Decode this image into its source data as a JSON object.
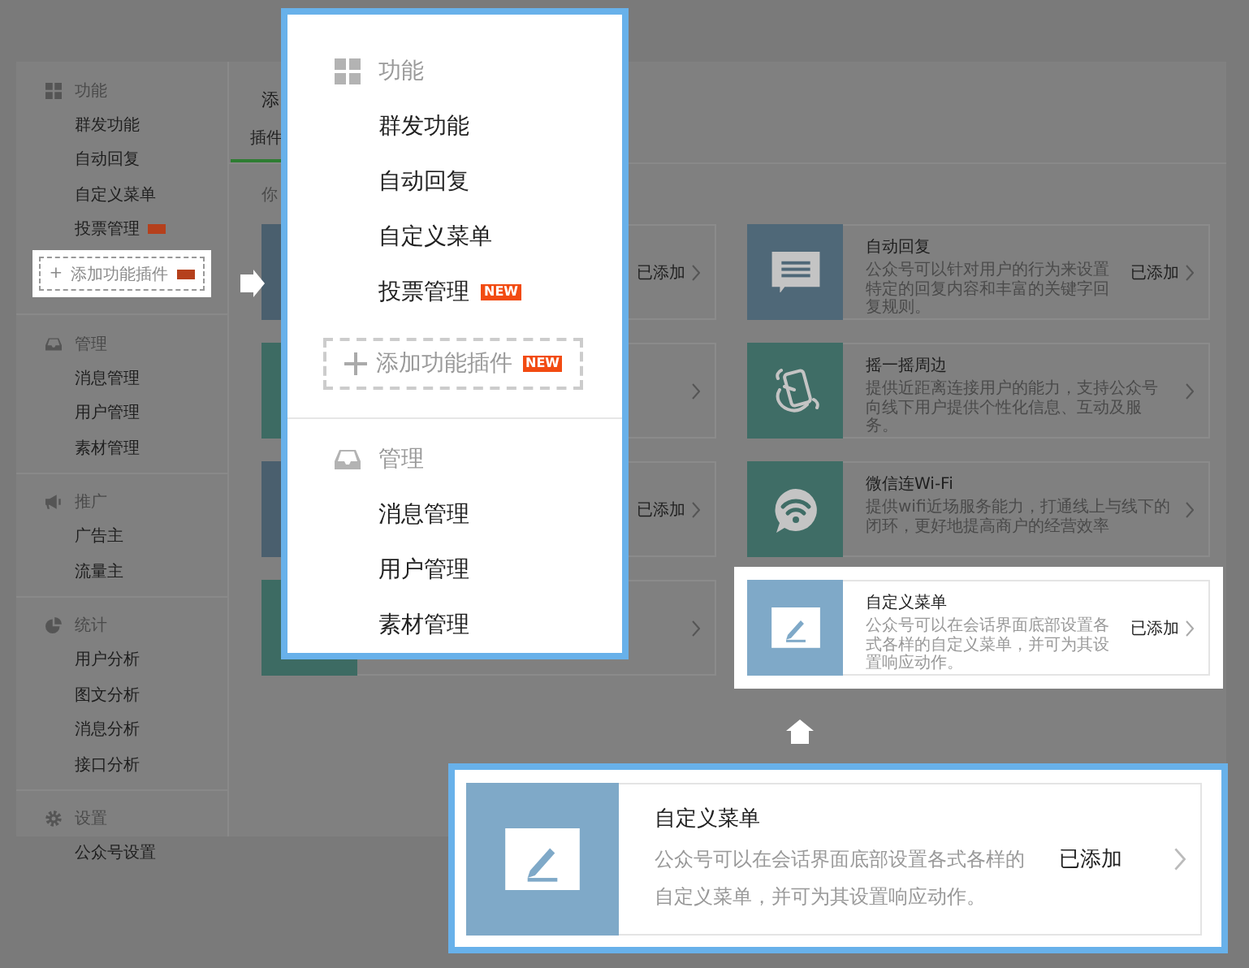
{
  "sidebar": {
    "sections": [
      {
        "title": "功能",
        "items": [
          {
            "label": "群发功能",
            "new": false
          },
          {
            "label": "自动回复",
            "new": false
          },
          {
            "label": "自定义菜单",
            "new": false
          },
          {
            "label": "投票管理",
            "new": true
          }
        ],
        "add_button": {
          "symbol": "+",
          "label": "添加功能插件",
          "new": true,
          "highlighted": true
        }
      },
      {
        "title": "管理",
        "items": [
          {
            "label": "消息管理",
            "new": false
          },
          {
            "label": "用户管理",
            "new": false
          },
          {
            "label": "素材管理",
            "new": false
          }
        ]
      },
      {
        "title": "推广",
        "items": [
          {
            "label": "广告主",
            "new": false
          },
          {
            "label": "流量主",
            "new": false
          }
        ]
      },
      {
        "title": "统计",
        "items": [
          {
            "label": "用户分析",
            "new": false
          },
          {
            "label": "图文分析",
            "new": false
          },
          {
            "label": "消息分析",
            "new": false
          },
          {
            "label": "接口分析",
            "new": false
          }
        ]
      },
      {
        "title": "设置",
        "items": [
          {
            "label": "公众号设置",
            "new": false
          }
        ]
      }
    ]
  },
  "main": {
    "title": "添",
    "tab": "插件",
    "hint": "你",
    "cards": [
      {
        "color": "#4a5f6e",
        "status": "已添加",
        "highlighted": false
      },
      {
        "color": "#4f6878",
        "title": "自动回复",
        "description": "公众号可以针对用户的行为来设置特定的回复内容和丰富的关键字回复规则。",
        "status": "已添加",
        "highlighted": false
      },
      {
        "color": "#3d6b63",
        "highlighted": false
      },
      {
        "color": "#3f6d66",
        "title": "摇一摇周边",
        "description": "提供近距离连接用户的能力，支持公众号向线下用户提供个性化信息、互动及服务。",
        "highlighted": false
      },
      {
        "color": "#4a5f6e",
        "status": "已添加",
        "highlighted": false
      },
      {
        "color": "#3f6d66",
        "title": "微信连Wi-Fi",
        "description": "提供wifi近场服务能力，打通线上与线下的闭环，更好地提高商户的经营效率",
        "highlighted": false
      },
      {
        "color": "#3d6b63",
        "highlighted": false
      },
      {
        "color": "#7fa9c8",
        "title": "自定义菜单",
        "description": "公众号可以在会话界面底部设置各式各样的自定义菜单，并可为其设置响应动作。",
        "status": "已添加",
        "highlighted": true
      }
    ]
  },
  "sidebar_zoom": {
    "sections": [
      {
        "title": "功能",
        "items": [
          {
            "label": "群发功能"
          },
          {
            "label": "自动回复"
          },
          {
            "label": "自定义菜单"
          },
          {
            "label": "投票管理",
            "badge": "NEW"
          }
        ],
        "add_button": {
          "label": "添加功能插件",
          "badge": "NEW"
        }
      },
      {
        "title": "管理",
        "items": [
          {
            "label": "消息管理"
          },
          {
            "label": "用户管理"
          },
          {
            "label": "素材管理"
          }
        ]
      }
    ]
  },
  "card_zoom": {
    "color": "#7fa9c8",
    "title": "自定义菜单",
    "description": "公众号可以在会话界面底部设置各式各样的自定义菜单，并可为其设置响应动作。",
    "status": "已添加"
  }
}
